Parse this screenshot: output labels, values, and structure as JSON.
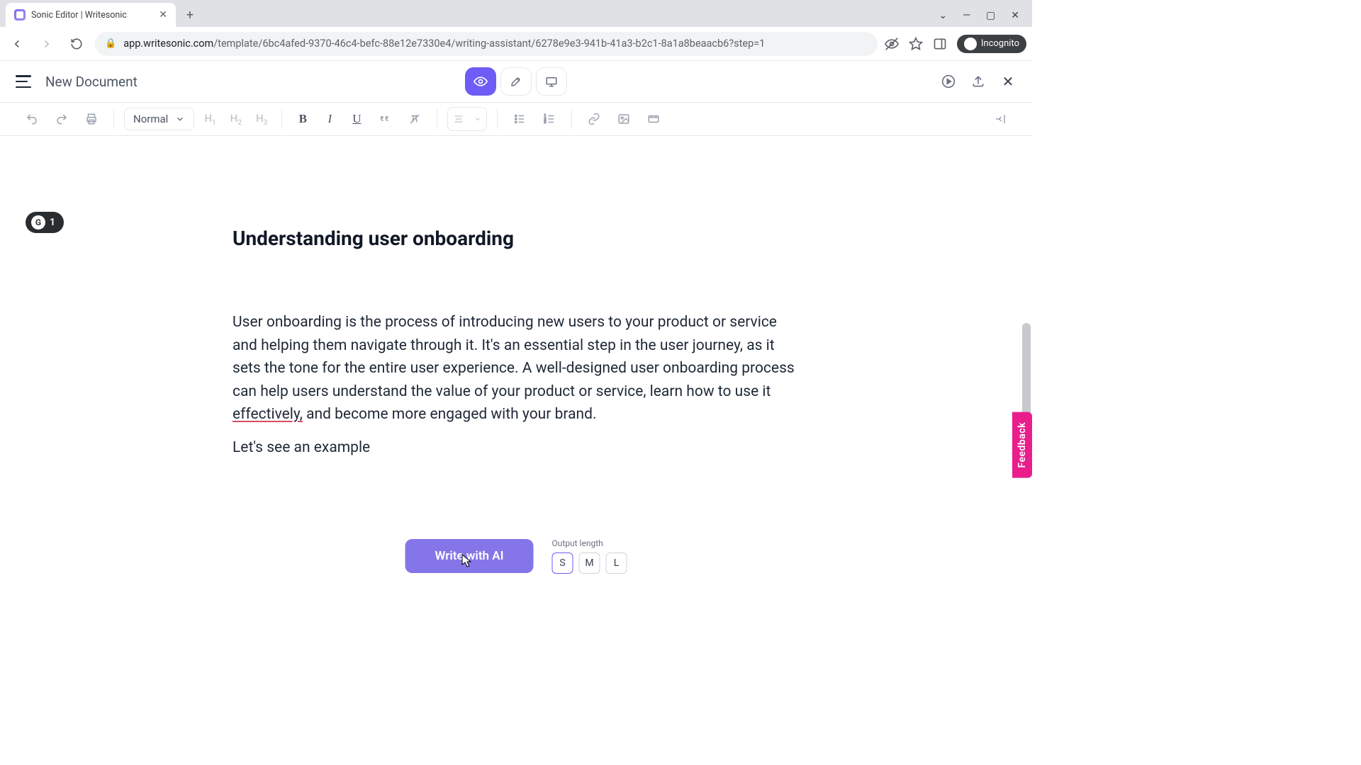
{
  "browser": {
    "tab_title": "Sonic Editor | Writesonic",
    "url_host": "app.writesonic.com",
    "url_path": "/template/6bc4afed-9370-46c4-befc-88e12e7330e4/writing-assistant/6278e9e3-941b-41a3-b2c1-8a1a8beaacb6?step=1",
    "incognito_label": "Incognito"
  },
  "header": {
    "doc_title": "New Document"
  },
  "toolbar": {
    "style": "Normal",
    "h1": "H",
    "h1s": "1",
    "h2": "H",
    "h2s": "2",
    "h3": "H",
    "h3s": "3"
  },
  "badge": {
    "letter": "G",
    "count": "1"
  },
  "document": {
    "heading": "Understanding user onboarding",
    "p1a": "User onboarding is the process of introducing new users to your product or service and helping them navigate through it. It's an essential step in the user journey, as it sets the tone for the entire user experience. A well-designed user onboarding process can help users understand the value of your product or service, learn how to use it ",
    "p1u": "effectively,",
    "p1b": " and become more engaged with your brand.",
    "p2": "Let's see an example"
  },
  "feedback": "Feedback",
  "bottom": {
    "write_btn": "Write with AI",
    "out_label": "Output length",
    "opts": [
      "S",
      "M",
      "L"
    ]
  }
}
